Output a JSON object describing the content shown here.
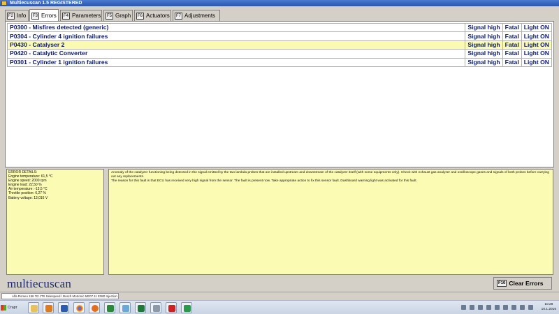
{
  "window": {
    "title": "Multiecuscan 1.5 REGISTERED"
  },
  "tabs": [
    {
      "key": "F2",
      "label": "Info"
    },
    {
      "key": "F3",
      "label": "Errors"
    },
    {
      "key": "F4",
      "label": "Parameters"
    },
    {
      "key": "F5",
      "label": "Graph"
    },
    {
      "key": "F6",
      "label": "Actuators"
    },
    {
      "key": "F7",
      "label": "Adjustments"
    }
  ],
  "errors": [
    {
      "description": "P0300 - Misfires detected (generic)",
      "signal": "Signal high",
      "severity": "Fatal",
      "light": "Light ON"
    },
    {
      "description": "P0304 - Cylinder 4 ignition failures",
      "signal": "Signal high",
      "severity": "Fatal",
      "light": "Light ON"
    },
    {
      "description": "P0430 - Catalyser 2",
      "signal": "Signal high",
      "severity": "Fatal",
      "light": "Light ON"
    },
    {
      "description": "P0420 - Catalytic Converter",
      "signal": "Signal high",
      "severity": "Fatal",
      "light": "Light ON"
    },
    {
      "description": "P0301 - Cylinder 1 ignition failures",
      "signal": "Signal high",
      "severity": "Fatal",
      "light": "Light ON"
    }
  ],
  "selected_row": 2,
  "details": {
    "heading": "ERROR DETAILS:",
    "lines": [
      "Engine temperature: 61,5 °C",
      "Engine speed: 2000 rpm",
      "Engine load: 22,50 %",
      "Air temperature: -13,5 °C",
      "Throttle position: 6,27 %",
      "Battery voltage: 13,016 V"
    ]
  },
  "description": {
    "line1": "Anomaly of the catalyzer functioning being detected in the signal emitted by the two lambda probes that are installed upstream and downstream of the catalyzer itself (with some equipments only). Check with exhaust gas analyzer and oscilloscope gases and signals of both probes before carrying out any replacements.",
    "line2": "The reason for this fault is that ECU has received very high signal from the sensor. The fault is present now. Take appropriate action to fix this sensor fault. Dashboard warning light was activated for this fault."
  },
  "brand": "multiecuscan",
  "clear_button": {
    "key": "F10",
    "label": "Clear Errors"
  },
  "session_tab": "Alfa Romeo 156 '02 JTS Selespeed / Bosch Motronic ME07.11 E080 Injection",
  "taskbar": {
    "start_label": "Старт",
    "clock_time": "10:28",
    "clock_date": "10.1.2016"
  },
  "colors": {
    "accent": "#0a1a70",
    "selection": "#fafab0",
    "panel": "#fbfbb4"
  }
}
